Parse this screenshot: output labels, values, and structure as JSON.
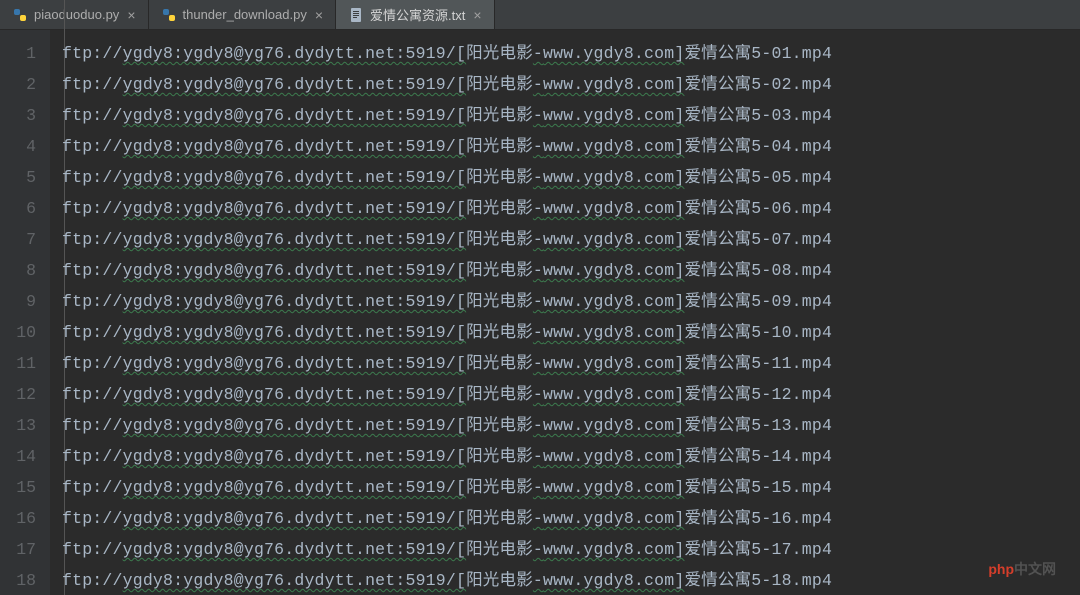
{
  "tabs": [
    {
      "label": "piaoduoduo.py",
      "type": "py",
      "active": false
    },
    {
      "label": "thunder_download.py",
      "type": "py",
      "active": false
    },
    {
      "label": "爱情公寓资源.txt",
      "type": "txt",
      "active": true
    }
  ],
  "lines": [
    {
      "n": "1",
      "a": "ftp://",
      "b": "ygdy8:ygdy8@yg76.dydytt.net:5919/[",
      "c": "阳光电影",
      "d": "-",
      "e": "www.ygdy8.com]",
      "f": "爱情公寓",
      "g": "5-01.mp4"
    },
    {
      "n": "2",
      "a": "ftp://",
      "b": "ygdy8:ygdy8@yg76.dydytt.net:5919/[",
      "c": "阳光电影",
      "d": "-",
      "e": "www.ygdy8.com]",
      "f": "爱情公寓",
      "g": "5-02.mp4"
    },
    {
      "n": "3",
      "a": "ftp://",
      "b": "ygdy8:ygdy8@yg76.dydytt.net:5919/[",
      "c": "阳光电影",
      "d": "-",
      "e": "www.ygdy8.com]",
      "f": "爱情公寓",
      "g": "5-03.mp4"
    },
    {
      "n": "4",
      "a": "ftp://",
      "b": "ygdy8:ygdy8@yg76.dydytt.net:5919/[",
      "c": "阳光电影",
      "d": "-",
      "e": "www.ygdy8.com]",
      "f": "爱情公寓",
      "g": "5-04.mp4"
    },
    {
      "n": "5",
      "a": "ftp://",
      "b": "ygdy8:ygdy8@yg76.dydytt.net:5919/[",
      "c": "阳光电影",
      "d": "-",
      "e": "www.ygdy8.com]",
      "f": "爱情公寓",
      "g": "5-05.mp4"
    },
    {
      "n": "6",
      "a": "ftp://",
      "b": "ygdy8:ygdy8@yg76.dydytt.net:5919/[",
      "c": "阳光电影",
      "d": "-",
      "e": "www.ygdy8.com]",
      "f": "爱情公寓",
      "g": "5-06.mp4"
    },
    {
      "n": "7",
      "a": "ftp://",
      "b": "ygdy8:ygdy8@yg76.dydytt.net:5919/[",
      "c": "阳光电影",
      "d": "-",
      "e": "www.ygdy8.com]",
      "f": "爱情公寓",
      "g": "5-07.mp4"
    },
    {
      "n": "8",
      "a": "ftp://",
      "b": "ygdy8:ygdy8@yg76.dydytt.net:5919/[",
      "c": "阳光电影",
      "d": "-",
      "e": "www.ygdy8.com]",
      "f": "爱情公寓",
      "g": "5-08.mp4"
    },
    {
      "n": "9",
      "a": "ftp://",
      "b": "ygdy8:ygdy8@yg76.dydytt.net:5919/[",
      "c": "阳光电影",
      "d": "-",
      "e": "www.ygdy8.com]",
      "f": "爱情公寓",
      "g": "5-09.mp4"
    },
    {
      "n": "10",
      "a": "ftp://",
      "b": "ygdy8:ygdy8@yg76.dydytt.net:5919/[",
      "c": "阳光电影",
      "d": "-",
      "e": "www.ygdy8.com]",
      "f": "爱情公寓",
      "g": "5-10.mp4"
    },
    {
      "n": "11",
      "a": "ftp://",
      "b": "ygdy8:ygdy8@yg76.dydytt.net:5919/[",
      "c": "阳光电影",
      "d": "-",
      "e": "www.ygdy8.com]",
      "f": "爱情公寓",
      "g": "5-11.mp4"
    },
    {
      "n": "12",
      "a": "ftp://",
      "b": "ygdy8:ygdy8@yg76.dydytt.net:5919/[",
      "c": "阳光电影",
      "d": "-",
      "e": "www.ygdy8.com]",
      "f": "爱情公寓",
      "g": "5-12.mp4"
    },
    {
      "n": "13",
      "a": "ftp://",
      "b": "ygdy8:ygdy8@yg76.dydytt.net:5919/[",
      "c": "阳光电影",
      "d": "-",
      "e": "www.ygdy8.com]",
      "f": "爱情公寓",
      "g": "5-13.mp4"
    },
    {
      "n": "14",
      "a": "ftp://",
      "b": "ygdy8:ygdy8@yg76.dydytt.net:5919/[",
      "c": "阳光电影",
      "d": "-",
      "e": "www.ygdy8.com]",
      "f": "爱情公寓",
      "g": "5-14.mp4"
    },
    {
      "n": "15",
      "a": "ftp://",
      "b": "ygdy8:ygdy8@yg76.dydytt.net:5919/[",
      "c": "阳光电影",
      "d": "-",
      "e": "www.ygdy8.com]",
      "f": "爱情公寓",
      "g": "5-15.mp4"
    },
    {
      "n": "16",
      "a": "ftp://",
      "b": "ygdy8:ygdy8@yg76.dydytt.net:5919/[",
      "c": "阳光电影",
      "d": "-",
      "e": "www.ygdy8.com]",
      "f": "爱情公寓",
      "g": "5-16.mp4"
    },
    {
      "n": "17",
      "a": "ftp://",
      "b": "ygdy8:ygdy8@yg76.dydytt.net:5919/[",
      "c": "阳光电影",
      "d": "-",
      "e": "www.ygdy8.com]",
      "f": "爱情公寓",
      "g": "5-17.mp4"
    },
    {
      "n": "18",
      "a": "ftp://",
      "b": "ygdy8:ygdy8@yg76.dydytt.net:5919/[",
      "c": "阳光电影",
      "d": "-",
      "e": "www.ygdy8.com]",
      "f": "爱情公寓",
      "g": "5-18.mp4"
    }
  ],
  "badge": {
    "a": "php",
    "b": "中文网"
  }
}
